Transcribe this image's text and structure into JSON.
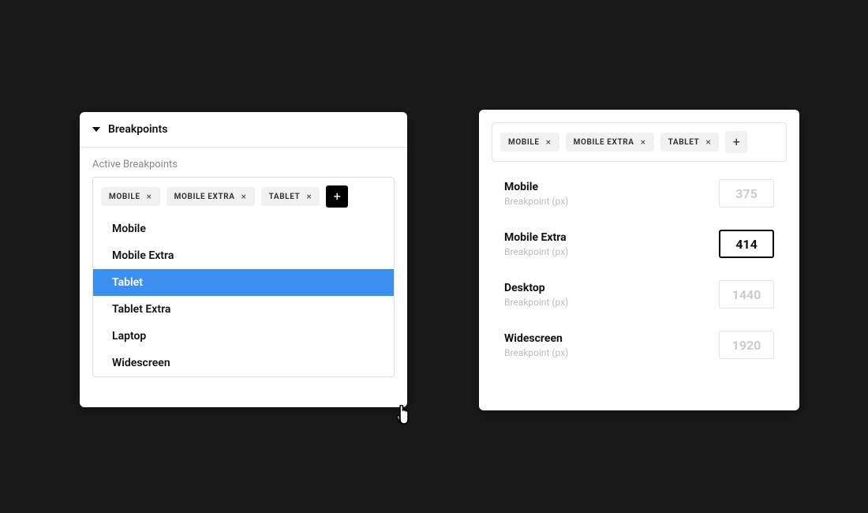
{
  "left": {
    "section_title": "Breakpoints",
    "subheading": "Active Breakpoints",
    "tags": [
      {
        "label": "MOBILE"
      },
      {
        "label": "MOBILE EXTRA"
      },
      {
        "label": "TABLET"
      }
    ],
    "add_icon": "+",
    "close_icon": "×",
    "dropdown": [
      {
        "label": "Mobile",
        "selected": false
      },
      {
        "label": "Mobile Extra",
        "selected": false
      },
      {
        "label": "Tablet",
        "selected": true
      },
      {
        "label": "Tablet Extra",
        "selected": false
      },
      {
        "label": "Laptop",
        "selected": false
      },
      {
        "label": "Widescreen",
        "selected": false
      }
    ]
  },
  "right": {
    "tags": [
      {
        "label": "MOBILE"
      },
      {
        "label": "MOBILE EXTRA"
      },
      {
        "label": "TABLET"
      }
    ],
    "add_icon": "+",
    "close_icon": "×",
    "rows": [
      {
        "name": "Mobile",
        "sub": "Breakpoint (px)",
        "value": "375",
        "active": false
      },
      {
        "name": "Mobile Extra",
        "sub": "Breakpoint (px)",
        "value": "414",
        "active": true
      },
      {
        "name": "Desktop",
        "sub": "Breakpoint (px)",
        "value": "1440",
        "active": false
      },
      {
        "name": "Widescreen",
        "sub": "Breakpoint (px)",
        "value": "1920",
        "active": false
      }
    ]
  }
}
